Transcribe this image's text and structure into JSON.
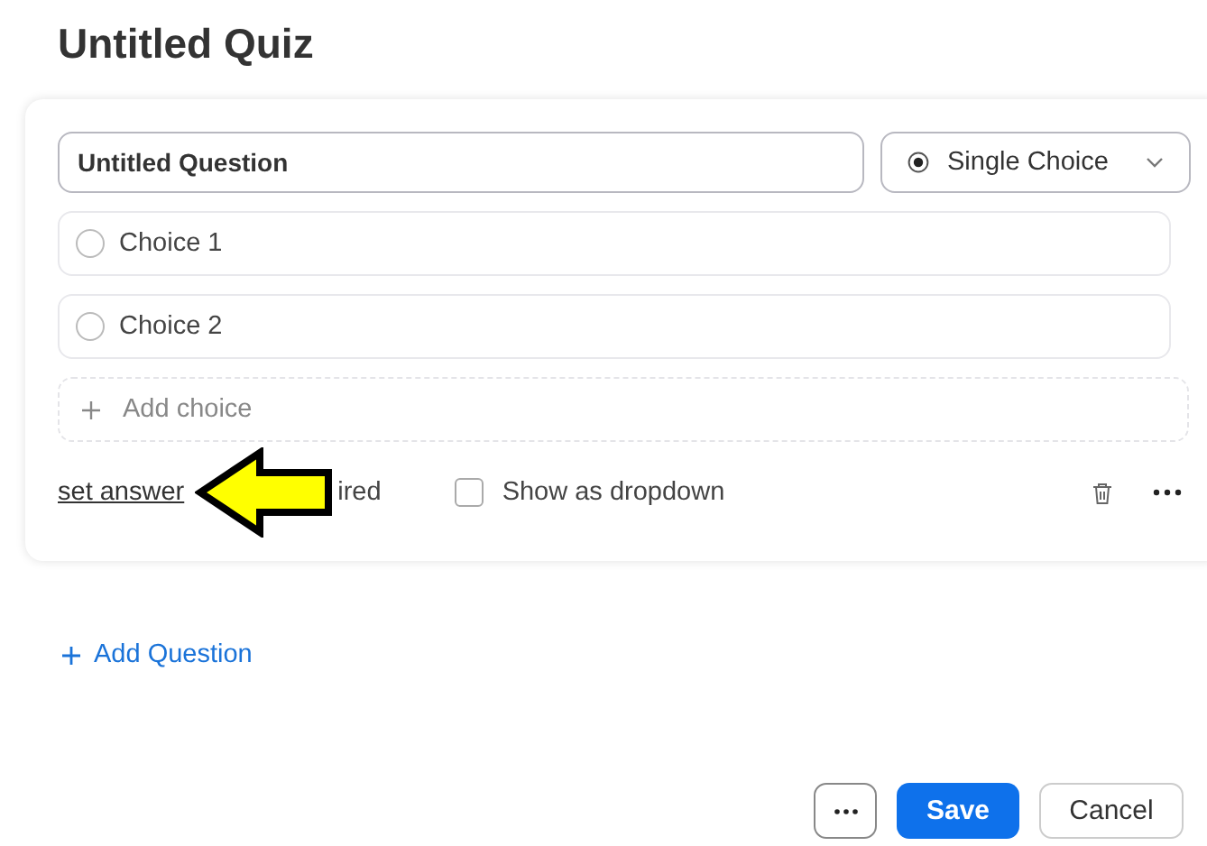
{
  "title": "Untitled Quiz",
  "question": {
    "value": "Untitled Question",
    "type_label": "Single Choice"
  },
  "choices": [
    {
      "label": "Choice 1",
      "selected": false
    },
    {
      "label": "Choice 2",
      "selected": false
    }
  ],
  "add_choice": "Add choice",
  "footer": {
    "set_answer": "set answer",
    "required_label": "ired",
    "show_as_dropdown": {
      "label": "Show as dropdown",
      "checked": false
    }
  },
  "add_question": "Add Question",
  "buttons": [
    {
      "kind": "more"
    },
    {
      "kind": "primary",
      "label": "Save"
    },
    {
      "kind": "secondary",
      "label": "Cancel"
    }
  ]
}
